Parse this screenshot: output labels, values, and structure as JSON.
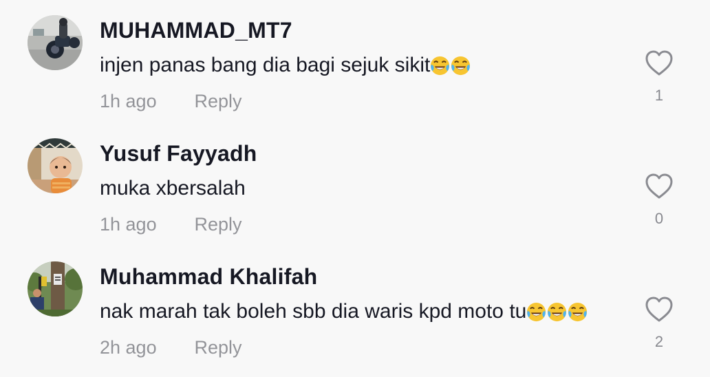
{
  "comments": [
    {
      "username": "MUHAMMAD_MT7",
      "text": "injen panas bang dia bagi sejuk sikit",
      "emoji_count": 2,
      "emoji_icon": "face-with-tears-of-joy-icon",
      "time": "1h ago",
      "reply_label": "Reply",
      "likes": "1",
      "avatar_icon": "motorcycle-rider-avatar"
    },
    {
      "username": "Yusuf Fayyadh",
      "text": "muka xbersalah",
      "emoji_count": 0,
      "time": "1h ago",
      "reply_label": "Reply",
      "likes": "0",
      "avatar_icon": "child-avatar"
    },
    {
      "username": "Muhammad Khalifah",
      "text": "nak marah tak boleh sbb dia waris kpd moto tu",
      "emoji_count": 3,
      "emoji_icon": "face-with-tears-of-joy-icon",
      "time": "2h ago",
      "reply_label": "Reply",
      "likes": "2",
      "avatar_icon": "outdoor-tree-avatar"
    }
  ],
  "colors": {
    "background": "#f8f8f8",
    "text_primary": "#161823",
    "text_secondary": "#a2a3a7",
    "heart_outline": "#8a8b91"
  }
}
